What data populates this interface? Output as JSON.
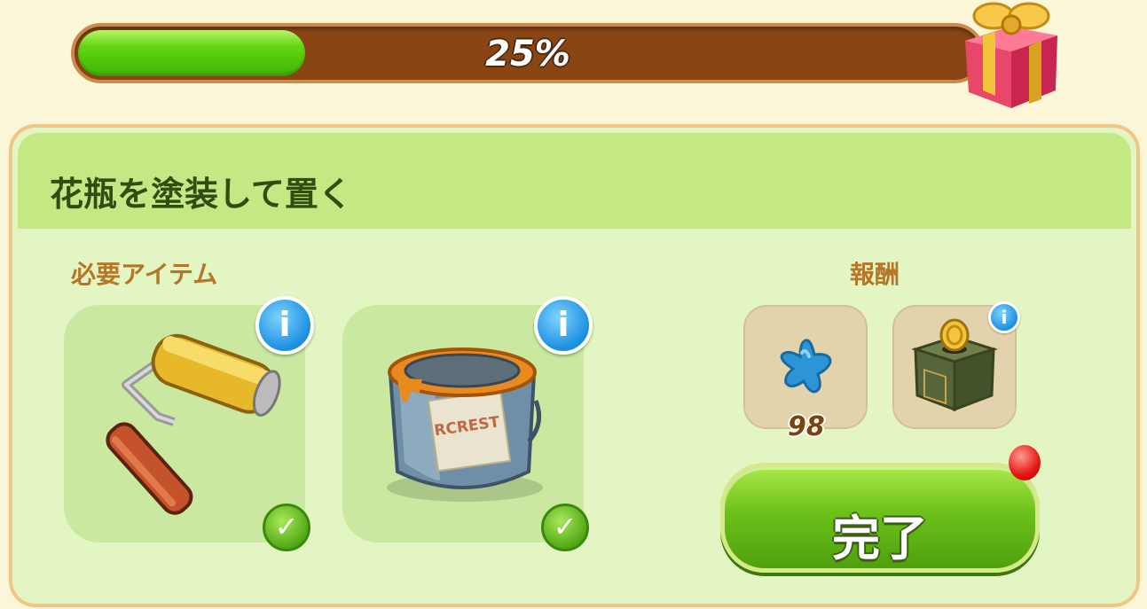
{
  "progress": {
    "label": "25%",
    "value": 0.25
  },
  "task": {
    "title": "花瓶を塗装して置く"
  },
  "required": {
    "label": "必要アイテム",
    "items": [
      {
        "name": "paint-roller",
        "completed": true
      },
      {
        "name": "paint-bucket",
        "completed": true,
        "can_text": "RCREST"
      }
    ]
  },
  "rewards": {
    "label": "報酬",
    "items": [
      {
        "name": "blue-star",
        "count": "98"
      },
      {
        "name": "coin-box"
      }
    ]
  },
  "buttons": {
    "complete": "完了"
  },
  "icons": {
    "info": "i",
    "check": "✓"
  },
  "colors": {
    "progress_fill": "#3fb305",
    "progress_track": "#8a4515",
    "header_bg": "#c4e884",
    "panel_bg": "#e3f5c2",
    "button_green": "#6cc11a"
  }
}
